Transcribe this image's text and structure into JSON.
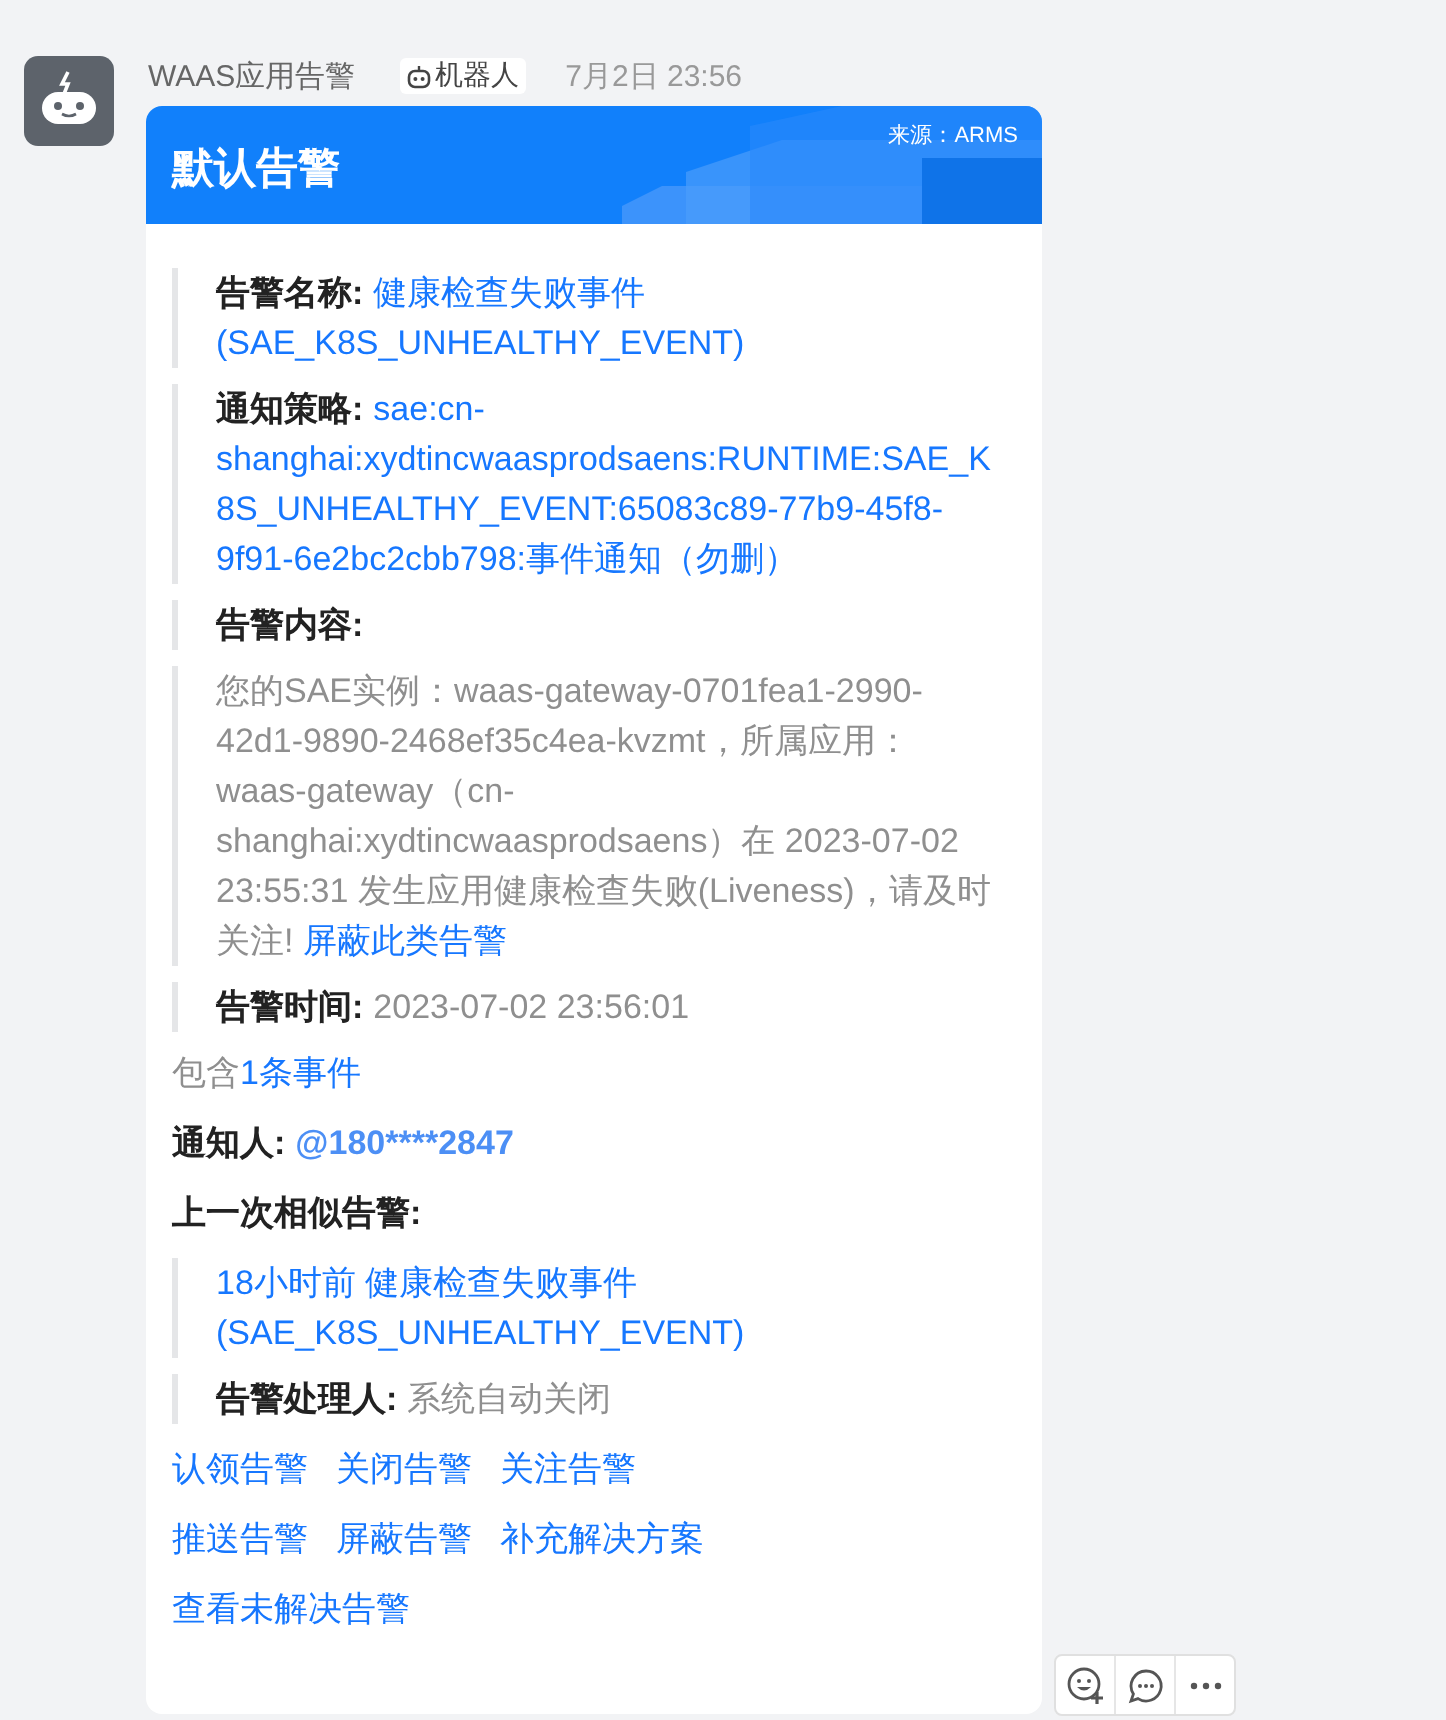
{
  "message": {
    "sender": "WAAS应用告警",
    "badge": "机器人",
    "time": "7月2日 23:56"
  },
  "card": {
    "title": "默认告警",
    "source": "来源：ARMS"
  },
  "sections": [
    {
      "kind": "link_field",
      "label": "告警名称:",
      "value": "健康检查失败事件(SAE_K8S_UNHEALTHY_EVENT)"
    },
    {
      "kind": "link_field",
      "label": "通知策略:",
      "value": "sae:cn-shanghai:xydtincwaasprodsaens:RUNTIME:SAE_K8S_UNHEALTHY_EVENT:65083c89-77b9-45f8-9f91-6e2bc2cbb798:事件通知（勿删）"
    },
    {
      "kind": "label",
      "label": "告警内容:"
    },
    {
      "kind": "paragraph",
      "text": "您的SAE实例：waas-gateway-0701fea1-2990-42d1-9890-2468ef35c4ea-kvzmt，所属应用：waas-gateway（cn-shanghai:xydtincwaasprodsaens）在 2023-07-02 23:55:31 发生应用健康检查失败(Liveness)，请及时关注!",
      "link": "屏蔽此类告警"
    },
    {
      "kind": "muted_field",
      "label": "告警时间:",
      "value": "2023-07-02 23:56:01"
    }
  ],
  "event_count": {
    "prefix": "包含",
    "link": "1条事件"
  },
  "notifier": {
    "label": "通知人:",
    "value": "@180****2847"
  },
  "similar": {
    "label": "上一次相似告警:",
    "items": [
      {
        "kind": "link",
        "text": "18小时前 健康检查失败事件(SAE_K8S_UNHEALTHY_EVENT)"
      },
      {
        "kind": "muted_field",
        "label": "告警处理人:",
        "value": "系统自动关闭"
      }
    ]
  },
  "actions": [
    [
      "认领告警",
      "关闭告警",
      "关注告警"
    ],
    [
      "推送告警",
      "屏蔽告警",
      "补充解决方案"
    ],
    [
      "查看未解决告警"
    ]
  ]
}
